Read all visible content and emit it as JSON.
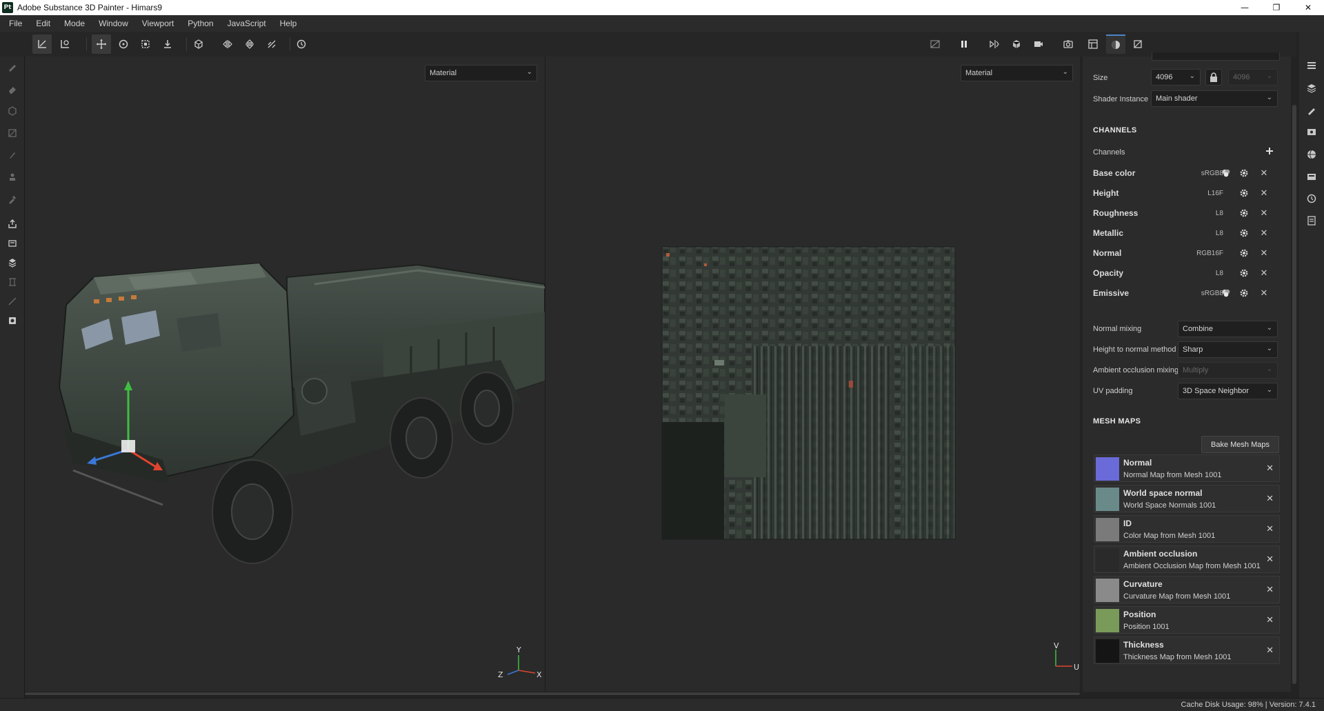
{
  "window": {
    "title": "Adobe Substance 3D Painter - Himars9",
    "logo_text": "Pt",
    "controls": [
      "—",
      "❐",
      "✕"
    ]
  },
  "menu": [
    "File",
    "Edit",
    "Mode",
    "Window",
    "Viewport",
    "Python",
    "JavaScript",
    "Help"
  ],
  "viewport3d": {
    "mode": "Material",
    "axis": {
      "x": "X",
      "y": "Y",
      "z": "Z"
    }
  },
  "viewport2d": {
    "mode": "Material",
    "axis": {
      "u": "U",
      "v": "V"
    }
  },
  "texture_set": {
    "size_label": "Size",
    "size_value": "4096",
    "size_value_linked": "4096",
    "shader_label": "Shader Instance",
    "shader_value": "Main shader"
  },
  "channels": {
    "section_title": "CHANNELS",
    "label": "Channels",
    "add_icon": "plus-icon",
    "list": [
      {
        "name": "Base color",
        "format": "sRGB8",
        "has_color_icon": true
      },
      {
        "name": "Height",
        "format": "L16F",
        "has_color_icon": false
      },
      {
        "name": "Roughness",
        "format": "L8",
        "has_color_icon": false
      },
      {
        "name": "Metallic",
        "format": "L8",
        "has_color_icon": false
      },
      {
        "name": "Normal",
        "format": "RGB16F",
        "has_color_icon": false
      },
      {
        "name": "Opacity",
        "format": "L8",
        "has_color_icon": false
      },
      {
        "name": "Emissive",
        "format": "sRGB8",
        "has_color_icon": true
      }
    ]
  },
  "settings": {
    "normal_mixing": {
      "label": "Normal mixing",
      "value": "Combine"
    },
    "height_to_normal": {
      "label": "Height to normal method",
      "value": "Sharp"
    },
    "ao_mixing": {
      "label": "Ambient occlusion mixing",
      "value": "Multiply"
    },
    "uv_padding": {
      "label": "UV padding",
      "value": "3D Space Neighbor"
    }
  },
  "mesh_maps": {
    "section_title": "MESH MAPS",
    "bake_button": "Bake Mesh Maps",
    "list": [
      {
        "title": "Normal",
        "subtitle": "Normal Map from Mesh 1001",
        "color": "#6a6ad8"
      },
      {
        "title": "World space normal",
        "subtitle": "World Space Normals 1001",
        "color": "#6a8a8a"
      },
      {
        "title": "ID",
        "subtitle": "Color Map from Mesh 1001",
        "color": "#7a7a7a"
      },
      {
        "title": "Ambient occlusion",
        "subtitle": "Ambient Occlusion Map from Mesh 1001",
        "color": "#2a2a2a"
      },
      {
        "title": "Curvature",
        "subtitle": "Curvature Map from Mesh 1001",
        "color": "#8a8a8a"
      },
      {
        "title": "Position",
        "subtitle": "Position 1001",
        "color": "#7a9a5a"
      },
      {
        "title": "Thickness",
        "subtitle": "Thickness Map from Mesh 1001",
        "color": "#151515"
      }
    ]
  },
  "status": {
    "cache": "Cache Disk Usage:   98% | Version: 7.4.1"
  },
  "colors": {
    "accent": "#4a86c5",
    "panel_bg": "#2b2b2b",
    "viewport_bg": "#2a2a2a"
  }
}
